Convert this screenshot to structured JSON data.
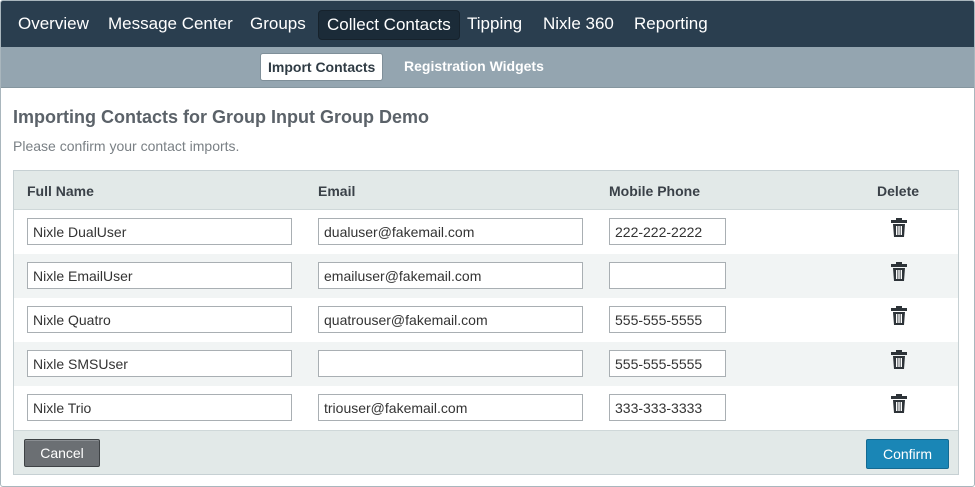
{
  "nav": {
    "tabs": [
      "Overview",
      "Message Center",
      "Groups",
      "Collect Contacts",
      "Tipping",
      "Nixle 360",
      "Reporting"
    ],
    "active": "Collect Contacts"
  },
  "subnav": {
    "tabs": [
      "Import Contacts",
      "Registration Widgets"
    ],
    "active": "Import Contacts"
  },
  "page": {
    "title": "Importing Contacts for Group Input Group Demo",
    "subtitle": "Please confirm your contact imports."
  },
  "table": {
    "headers": {
      "full_name": "Full Name",
      "email": "Email",
      "mobile_phone": "Mobile Phone",
      "delete": "Delete"
    },
    "rows": [
      {
        "full_name": "Nixle DualUser",
        "email": "dualuser@fakemail.com",
        "mobile_phone": "222-222-2222"
      },
      {
        "full_name": "Nixle EmailUser",
        "email": "emailuser@fakemail.com",
        "mobile_phone": ""
      },
      {
        "full_name": "Nixle Quatro",
        "email": "quatrouser@fakemail.com",
        "mobile_phone": "555-555-5555"
      },
      {
        "full_name": "Nixle SMSUser",
        "email": "",
        "mobile_phone": "555-555-5555"
      },
      {
        "full_name": "Nixle Trio",
        "email": "triouser@fakemail.com",
        "mobile_phone": "333-333-3333"
      }
    ],
    "delete_icon": "trash-icon"
  },
  "actions": {
    "cancel_label": "Cancel",
    "confirm_label": "Confirm"
  },
  "colors": {
    "nav_bg": "#2a3e4f",
    "subnav_bg": "#94a5b0",
    "confirm_bg": "#1a86b6",
    "cancel_bg": "#6b6f73"
  }
}
